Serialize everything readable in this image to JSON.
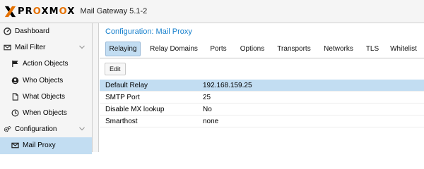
{
  "header": {
    "logo_text": "PROXMOX",
    "app_title": "Mail Gateway 5.1-2",
    "brand_color": "#e57000"
  },
  "sidebar": {
    "items": [
      {
        "label": "Dashboard",
        "icon": "dashboard-icon"
      },
      {
        "label": "Mail Filter",
        "icon": "envelope-icon"
      },
      {
        "label": "Action Objects",
        "icon": "flag-icon"
      },
      {
        "label": "Who Objects",
        "icon": "user-icon"
      },
      {
        "label": "What Objects",
        "icon": "file-icon"
      },
      {
        "label": "When Objects",
        "icon": "clock-icon"
      },
      {
        "label": "Configuration",
        "icon": "gears-icon"
      },
      {
        "label": "Mail Proxy",
        "icon": "envelope-icon"
      }
    ],
    "selected": "Mail Proxy"
  },
  "main": {
    "title": "Configuration: Mail Proxy",
    "tabs": [
      {
        "label": "Relaying"
      },
      {
        "label": "Relay Domains"
      },
      {
        "label": "Ports"
      },
      {
        "label": "Options"
      },
      {
        "label": "Transports"
      },
      {
        "label": "Networks"
      },
      {
        "label": "TLS"
      },
      {
        "label": "Whitelist"
      }
    ],
    "active_tab": "Relaying",
    "edit_label": "Edit",
    "rows": [
      {
        "name": "Default Relay",
        "value": "192.168.159.25"
      },
      {
        "name": "SMTP Port",
        "value": "25"
      },
      {
        "name": "Disable MX lookup",
        "value": "No"
      },
      {
        "name": "Smarthost",
        "value": "none"
      }
    ],
    "selected_row": "Default Relay"
  },
  "colors": {
    "accent": "#157fcc",
    "selection": "#c2ddf2"
  }
}
